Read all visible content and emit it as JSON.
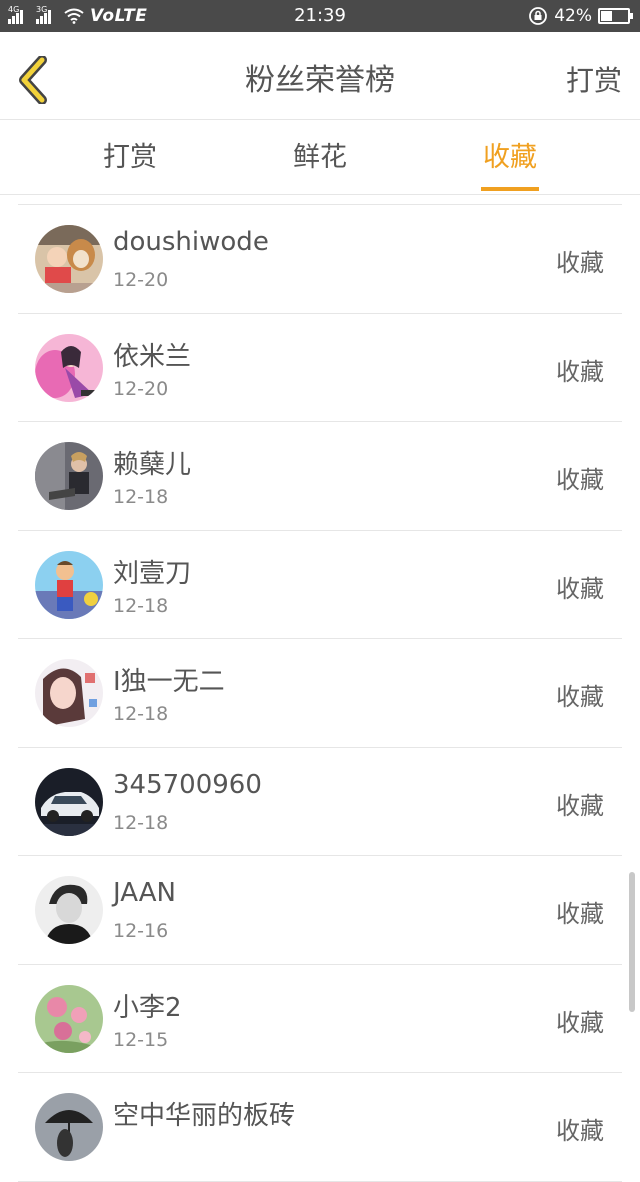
{
  "status_bar": {
    "signal1_tag": "4G",
    "signal2_tag": "3G",
    "volte": "VoLTE",
    "time": "21:39",
    "battery": "42%",
    "battery_level": 0.42
  },
  "header": {
    "title": "粉丝荣誉榜",
    "action": "打赏",
    "accent_color": "#f0a020"
  },
  "tabs": [
    {
      "label": "打赏",
      "active": false
    },
    {
      "label": "鲜花",
      "active": false
    },
    {
      "label": "收藏",
      "active": true
    }
  ],
  "rows": [
    {
      "name": "doushiwode",
      "date": "12-20",
      "kind": "收藏",
      "avatar_icon": "child-dog-photo-icon"
    },
    {
      "name": "依米兰",
      "date": "12-20",
      "kind": "收藏",
      "avatar_icon": "pink-anime-girl-icon"
    },
    {
      "name": "赖蘖儿",
      "date": "12-18",
      "kind": "收藏",
      "avatar_icon": "person-sitting-photo-icon"
    },
    {
      "name": "刘壹刀",
      "date": "12-18",
      "kind": "收藏",
      "avatar_icon": "cartoon-hero-icon"
    },
    {
      "name": "I独一无二",
      "date": "12-18",
      "kind": "收藏",
      "avatar_icon": "girl-portrait-icon"
    },
    {
      "name": "345700960",
      "date": "12-18",
      "kind": "收藏",
      "avatar_icon": "white-car-icon"
    },
    {
      "name": "JAAN",
      "date": "12-16",
      "kind": "收藏",
      "avatar_icon": "bw-portrait-icon"
    },
    {
      "name": "小李2",
      "date": "12-15",
      "kind": "收藏",
      "avatar_icon": "pink-flowers-icon"
    },
    {
      "name": "空中华丽的板砖",
      "date": "",
      "kind": "收藏",
      "avatar_icon": "umbrella-silhouette-icon"
    }
  ]
}
